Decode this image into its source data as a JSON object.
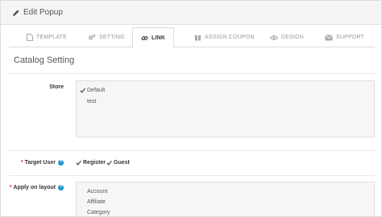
{
  "header": {
    "title": "Edit Popup",
    "icon": "pencil-icon"
  },
  "tabs": [
    {
      "label": "TEMPLATE",
      "icon": "file-icon"
    },
    {
      "label": "SETTING",
      "icon": "gears-icon"
    },
    {
      "label": "LINK",
      "icon": "link-icon",
      "active": true
    },
    {
      "label": "ASSIGN COUPON",
      "icon": "gift-icon"
    },
    {
      "label": "DESIGN",
      "icon": "eye-icon"
    },
    {
      "label": "SUPPORT",
      "icon": "envelope-icon"
    }
  ],
  "section": {
    "title": "Catalog Setting"
  },
  "store": {
    "label": "Store",
    "options": [
      {
        "label": "Default",
        "checked": true
      },
      {
        "label": "test",
        "checked": false
      }
    ]
  },
  "target_user": {
    "label": "Target User",
    "required": "*",
    "help": "?",
    "options": [
      {
        "label": "Register",
        "checked": true
      },
      {
        "label": "Guest",
        "checked": true
      }
    ]
  },
  "apply_on_layout": {
    "label": "Apply on layout",
    "required": "*",
    "help": "?",
    "options": [
      {
        "label": "Account",
        "checked": false
      },
      {
        "label": "Affiliate",
        "checked": false
      },
      {
        "label": "Category",
        "checked": false
      }
    ]
  },
  "colors": {
    "accent": "#1e91cf",
    "required": "#e02424",
    "heading_bg": "#f5f5f5",
    "box_bg": "#f6f6f6"
  }
}
